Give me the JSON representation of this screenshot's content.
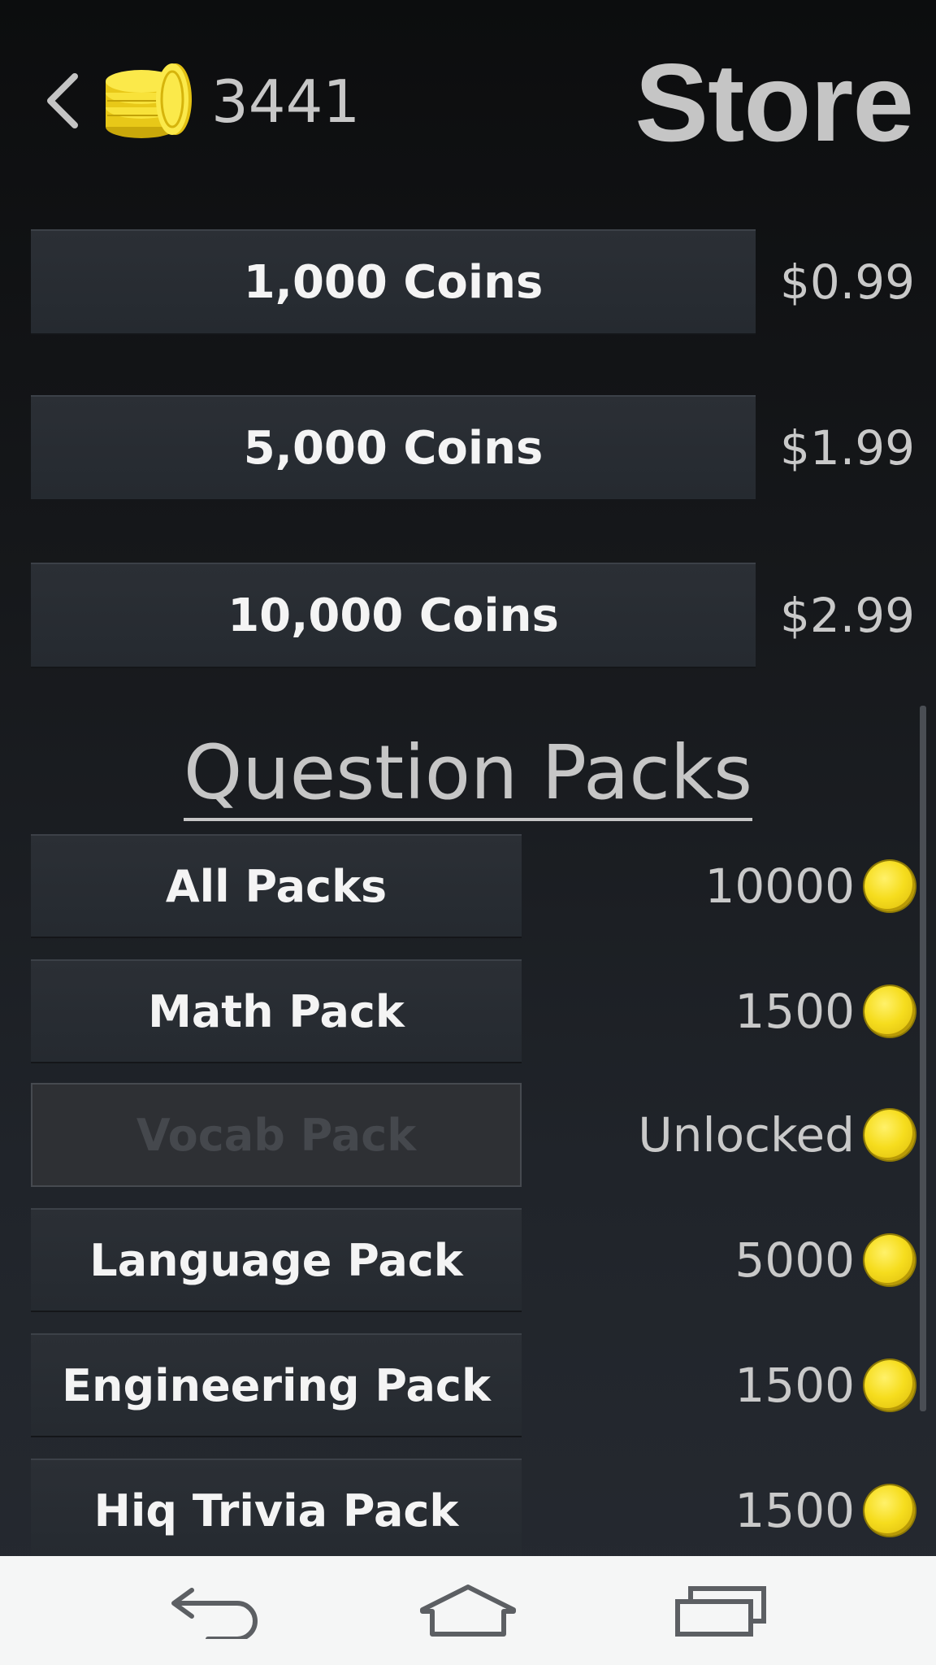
{
  "header": {
    "coin_balance": "3441",
    "title": "Store"
  },
  "coin_offers": [
    {
      "label": "1,000 Coins",
      "price": "$0.99"
    },
    {
      "label": "5,000 Coins",
      "price": "$1.99"
    },
    {
      "label": "10,000 Coins",
      "price": "$2.99"
    }
  ],
  "packs_section": {
    "heading": "Question Packs"
  },
  "packs": [
    {
      "label": "All Packs",
      "price": "10000",
      "enabled": true
    },
    {
      "label": "Math Pack",
      "price": "1500",
      "enabled": true
    },
    {
      "label": "Vocab Pack",
      "price": "Unlocked",
      "enabled": false
    },
    {
      "label": "Language Pack",
      "price": "5000",
      "enabled": true
    },
    {
      "label": "Engineering Pack",
      "price": "1500",
      "enabled": true
    },
    {
      "label": "Hiq Trivia Pack",
      "price": "1500",
      "enabled": true
    }
  ],
  "icons": {
    "back": "chevron-left-icon",
    "coin_stack": "coin-stack-icon",
    "coin": "coin-icon",
    "nav_back": "back-arrow-icon",
    "nav_home": "home-icon",
    "nav_recents": "recent-apps-icon"
  },
  "colors": {
    "coin_gold": "#f6dd1e",
    "button_bg": "#282c32",
    "button_text": "#f4f4f4",
    "disabled_text": "#45484d",
    "nav_bar_bg": "#f5f6f6"
  }
}
